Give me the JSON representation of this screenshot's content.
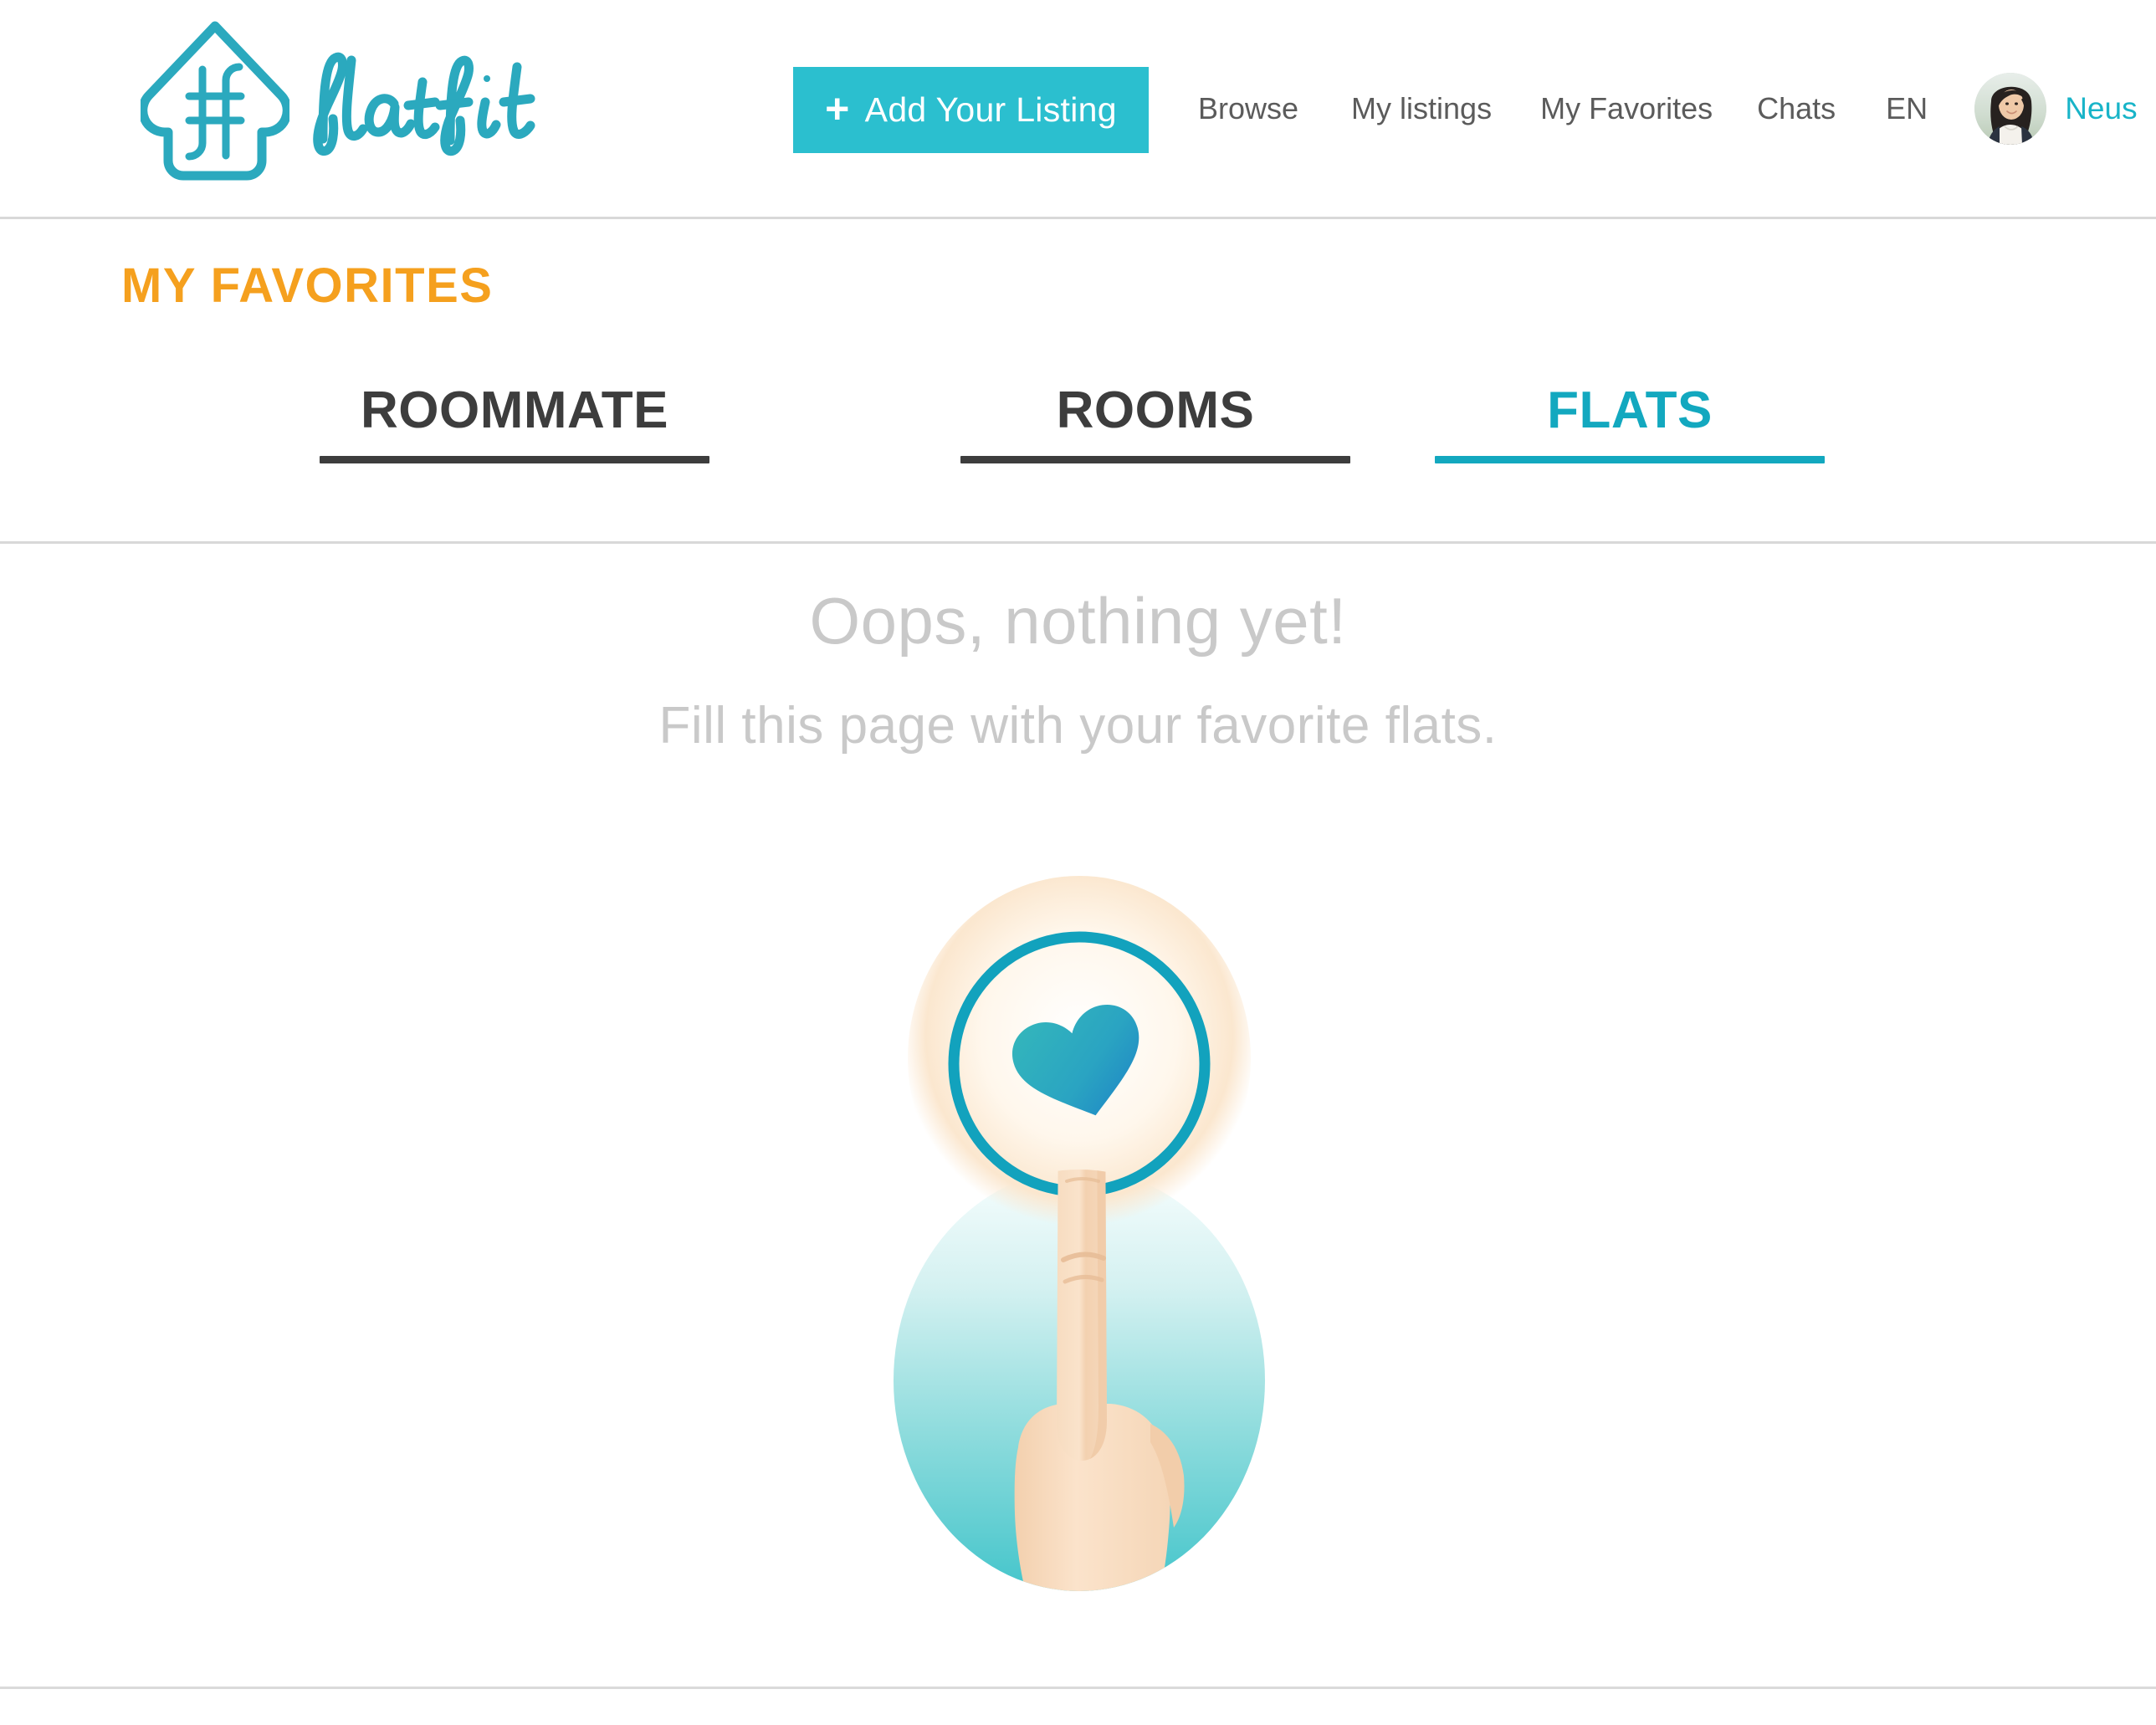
{
  "brand": {
    "name": "flatfit",
    "logo_icon": "house-monogram-icon",
    "color": "#2ba9be"
  },
  "header": {
    "add_listing": {
      "plus_icon": "plus-icon",
      "label": "Add Your Listing",
      "background": "#2bbfcf",
      "text_color": "#ffffff"
    },
    "nav_items": [
      {
        "label": "Browse"
      },
      {
        "label": "My listings"
      },
      {
        "label": "My Favorites"
      },
      {
        "label": "Chats"
      },
      {
        "label": "EN"
      }
    ],
    "nav_text_color": "#5b5b5b",
    "account": {
      "avatar_icon": "user-avatar-photo",
      "name": "Neus",
      "name_color": "#18b4c8",
      "chevron_icon": "chevron-down-icon"
    }
  },
  "page": {
    "title": "MY FAVORITES",
    "title_color": "#f5a01e"
  },
  "tabs": {
    "active_index": 2,
    "items": [
      {
        "label": "ROOMMATE",
        "color": "#3d3d3d",
        "active": false
      },
      {
        "label": "ROOMS",
        "color": "#3d3d3d",
        "active": false
      },
      {
        "label": "FLATS",
        "color": "#13a8bf",
        "active": true
      }
    ]
  },
  "empty_state": {
    "headline": "Oops, nothing yet!",
    "subtext": "Fill this page with your favorite flats.",
    "text_color": "#c9c9c9",
    "illustration": {
      "name": "finger-tapping-heart-button-illustration",
      "elements": [
        "teal-gradient-circle-background",
        "cream-glow-halo",
        "teal-ring-outline",
        "heart-icon",
        "pointing-hand-icon"
      ],
      "circle_ring_color": "#12a2bd",
      "heart_gradient_from": "#30b5bd",
      "heart_gradient_to": "#1f87c4",
      "backdrop_gradient_from": "#f1fbfb",
      "backdrop_gradient_to": "#4ac7cc",
      "skin_color": "#f8dcc2"
    }
  }
}
